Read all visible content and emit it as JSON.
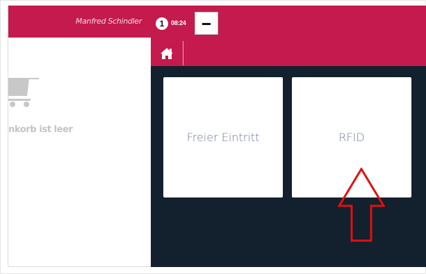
{
  "header": {
    "user_name": "Manfred Schindler",
    "queue_count": "1",
    "time": "08:24"
  },
  "cart": {
    "empty_text": "nkorb ist leer"
  },
  "tiles": [
    {
      "label": "Freier Eintritt"
    },
    {
      "label": "RFID"
    }
  ],
  "colors": {
    "brand": "#c41a4e",
    "dark_bg": "#13202d",
    "annotation_arrow": "#e01010"
  },
  "icons": {
    "home": "home-icon",
    "cart": "shopping-cart-icon",
    "minus": "minus-icon",
    "arrow": "up-arrow-annotation"
  }
}
